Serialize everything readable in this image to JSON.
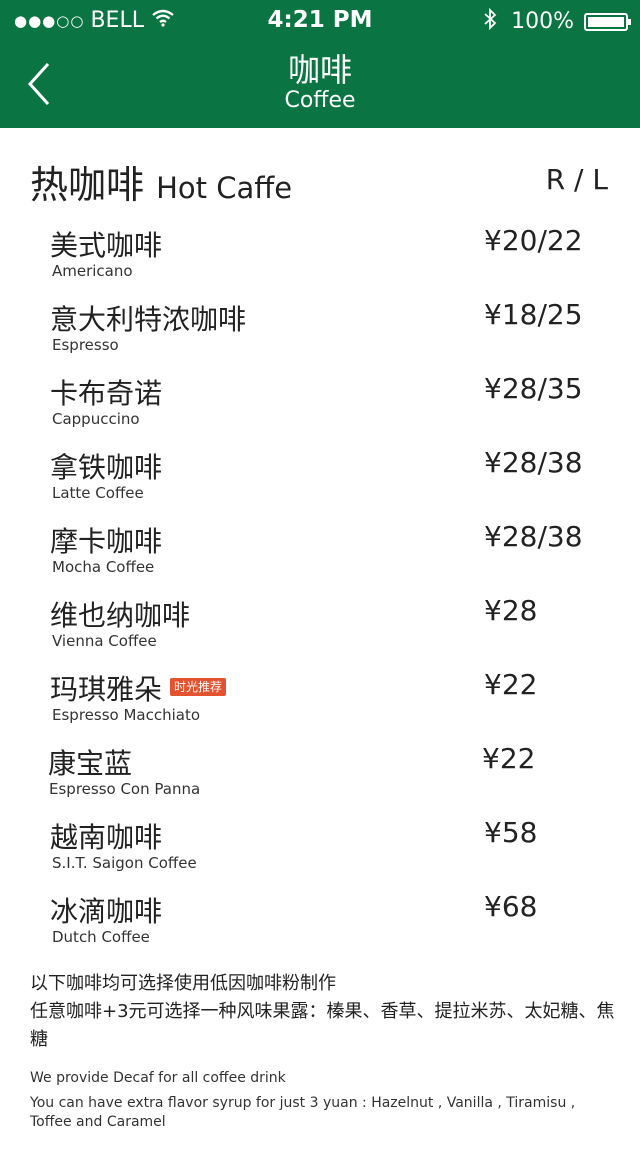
{
  "status_bar": {
    "signal": "●●●○○",
    "carrier": "BELL",
    "time": "4:21 PM",
    "battery": "100%"
  },
  "nav": {
    "title_cn": "咖啡",
    "title_en": "Coffee"
  },
  "section": {
    "title_cn": "热咖啡",
    "title_en": "Hot Caffe",
    "sizes": "R / L"
  },
  "items": [
    {
      "name": "美式咖啡",
      "ename": "Americano",
      "price": "¥20/22"
    },
    {
      "name": "意大利特浓咖啡",
      "ename": "Espresso",
      "price": "¥18/25"
    },
    {
      "name": "卡布奇诺",
      "ename": "Cappuccino",
      "price": "¥28/35"
    },
    {
      "name": "拿铁咖啡",
      "ename": "Latte Coffee",
      "price": "¥28/38"
    },
    {
      "name": "摩卡咖啡",
      "ename": "Mocha Coffee",
      "price": "¥28/38"
    },
    {
      "name": "维也纳咖啡",
      "ename": "Vienna Coffee",
      "price": "¥28"
    },
    {
      "name": "玛琪雅朵",
      "ename": "Espresso  Macchiato",
      "price": "¥22",
      "badge": "时光推荐"
    },
    {
      "name": "康宝蓝",
      "ename": "Espresso Con Panna",
      "price": "¥22"
    },
    {
      "name": "越南咖啡",
      "ename": "S.I.T. Saigon Coffee",
      "price": "¥58"
    },
    {
      "name": "冰滴咖啡",
      "ename": "Dutch Coffee",
      "price": "¥68"
    }
  ],
  "notes": {
    "cn_line1": "以下咖啡均可选择使用低因咖啡粉制作",
    "cn_line2": "任意咖啡+3元可选择一种风味果露：榛果、香草、提拉米苏、太妃糖、焦糖",
    "en_line1": "We provide Decaf for all coffee drink",
    "en_line2": "You can have extra flavor syrup for just 3 yuan : Hazelnut , Vanilla , Tiramisu , Toffee and Caramel"
  },
  "colors": {
    "header_bg": "#0a7442",
    "badge_bg": "#e3532f"
  }
}
